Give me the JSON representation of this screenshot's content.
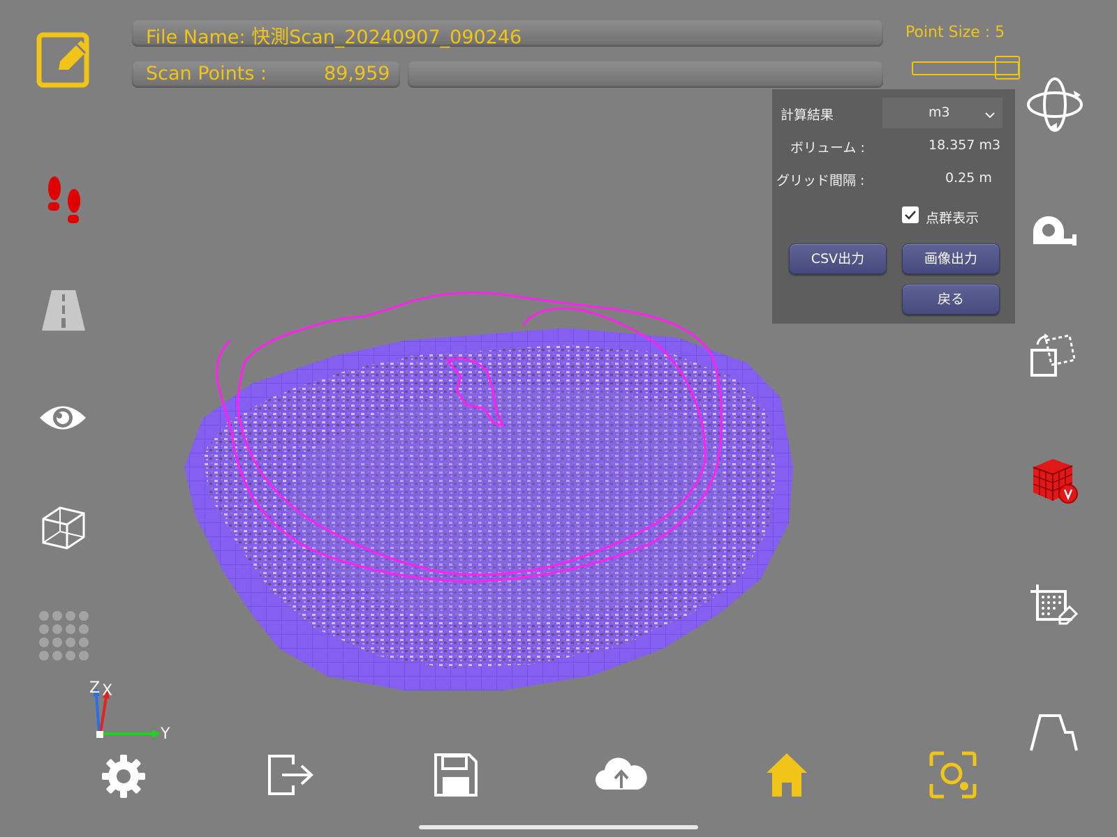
{
  "header": {
    "file_name": "File Name: 快測Scan_20240907_090246",
    "scan_points_label": "Scan Points :",
    "scan_points_value": "89,959",
    "point_size": "Point Size :  5"
  },
  "slider": {
    "level_fraction": 0.9
  },
  "result_panel": {
    "title": "計算結果",
    "unit_select": "m3",
    "volume_label": "ボリューム :",
    "volume_value": "18.357  m3",
    "grid_label": "グリッド間隔 :",
    "grid_value": "0.25  m",
    "checkbox_label": "点群表示",
    "checkbox_checked": true,
    "csv_button": "CSV出力",
    "image_button": "画像出力",
    "back_button": "戻る"
  },
  "axes": {
    "z": "Z",
    "x": "X",
    "y": "Y"
  },
  "left_toolbar": [
    "edit-icon",
    "footsteps-icon",
    "road-icon",
    "eye-icon",
    "cube-wireframe-icon",
    "dots-grid-icon"
  ],
  "right_toolbar": [
    "rotate-3d-icon",
    "tape-measure-icon",
    "transform-icon",
    "volume-cubes-icon",
    "area-select-icon",
    "profile-icon"
  ],
  "bottom_toolbar": [
    "settings-icon",
    "exit-icon",
    "save-icon",
    "cloud-upload-icon",
    "home-icon",
    "scan-camera-icon"
  ],
  "colors": {
    "background": "#7f7f7f",
    "accent_yellow": "#f0c419",
    "voxel_purple": "#7b55e8",
    "boundary_magenta": "#ff22ee",
    "volume_icon_red": "#e01818"
  }
}
